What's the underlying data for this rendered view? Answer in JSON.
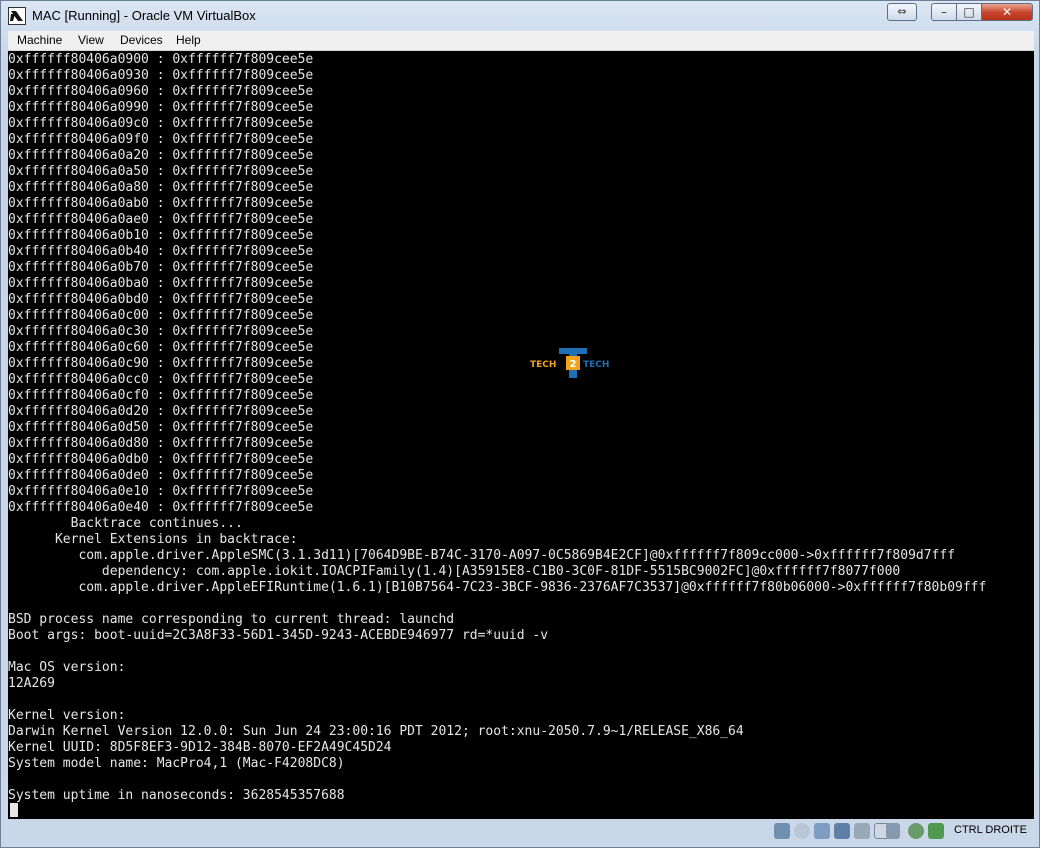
{
  "window": {
    "title": "MAC [Running] - Oracle VM VirtualBox"
  },
  "controls": {
    "restore": "⇔",
    "minimize": "–",
    "maximize": "□",
    "close": "✕"
  },
  "menu": [
    "Machine",
    "View",
    "Devices",
    "Help"
  ],
  "console_lines": [
    "0xffffff80406a0900 : 0xffffff7f809cee5e",
    "0xffffff80406a0930 : 0xffffff7f809cee5e",
    "0xffffff80406a0960 : 0xffffff7f809cee5e",
    "0xffffff80406a0990 : 0xffffff7f809cee5e",
    "0xffffff80406a09c0 : 0xffffff7f809cee5e",
    "0xffffff80406a09f0 : 0xffffff7f809cee5e",
    "0xffffff80406a0a20 : 0xffffff7f809cee5e",
    "0xffffff80406a0a50 : 0xffffff7f809cee5e",
    "0xffffff80406a0a80 : 0xffffff7f809cee5e",
    "0xffffff80406a0ab0 : 0xffffff7f809cee5e",
    "0xffffff80406a0ae0 : 0xffffff7f809cee5e",
    "0xffffff80406a0b10 : 0xffffff7f809cee5e",
    "0xffffff80406a0b40 : 0xffffff7f809cee5e",
    "0xffffff80406a0b70 : 0xffffff7f809cee5e",
    "0xffffff80406a0ba0 : 0xffffff7f809cee5e",
    "0xffffff80406a0bd0 : 0xffffff7f809cee5e",
    "0xffffff80406a0c00 : 0xffffff7f809cee5e",
    "0xffffff80406a0c30 : 0xffffff7f809cee5e",
    "0xffffff80406a0c60 : 0xffffff7f809cee5e",
    "0xffffff80406a0c90 : 0xffffff7f809cee5e",
    "0xffffff80406a0cc0 : 0xffffff7f809cee5e",
    "0xffffff80406a0cf0 : 0xffffff7f809cee5e",
    "0xffffff80406a0d20 : 0xffffff7f809cee5e",
    "0xffffff80406a0d50 : 0xffffff7f809cee5e",
    "0xffffff80406a0d80 : 0xffffff7f809cee5e",
    "0xffffff80406a0db0 : 0xffffff7f809cee5e",
    "0xffffff80406a0de0 : 0xffffff7f809cee5e",
    "0xffffff80406a0e10 : 0xffffff7f809cee5e",
    "0xffffff80406a0e40 : 0xffffff7f809cee5e",
    "        Backtrace continues...",
    "      Kernel Extensions in backtrace:",
    "         com.apple.driver.AppleSMC(3.1.3d11)[7064D9BE-B74C-3170-A097-0C5869B4E2CF]@0xffffff7f809cc000->0xffffff7f809d7fff",
    "            dependency: com.apple.iokit.IOACPIFamily(1.4)[A35915E8-C1B0-3C0F-81DF-5515BC9002FC]@0xffffff7f8077f000",
    "         com.apple.driver.AppleEFIRuntime(1.6.1)[B10B7564-7C23-3BCF-9836-2376AF7C3537]@0xffffff7f80b06000->0xffffff7f80b09fff",
    "",
    "BSD process name corresponding to current thread: launchd",
    "Boot args: boot-uuid=2C3A8F33-56D1-345D-9243-ACEBDE946977 rd=*uuid -v",
    "",
    "Mac OS version:",
    "12A269",
    "",
    "Kernel version:",
    "Darwin Kernel Version 12.0.0: Sun Jun 24 23:00:16 PDT 2012; root:xnu-2050.7.9~1/RELEASE_X86_64",
    "Kernel UUID: 8D5F8EF3-9D12-384B-8070-EF2A49C45D24",
    "System model name: MacPro4,1 (Mac-F4208DC8)",
    "",
    "System uptime in nanoseconds: 3628545357688"
  ],
  "watermark": {
    "left": "TECH",
    "middle": "2",
    "right": "TECH"
  },
  "statusbar": {
    "icons": [
      "hard-disk-icon",
      "optical-drive-icon",
      "usb-icon",
      "network-icon",
      "shared-folders-icon",
      "display-icon",
      "video-capture-icon",
      "cpu-icon",
      "mouse-integration-icon",
      "host-key-icon"
    ],
    "host_key": "CTRL DROITE"
  }
}
